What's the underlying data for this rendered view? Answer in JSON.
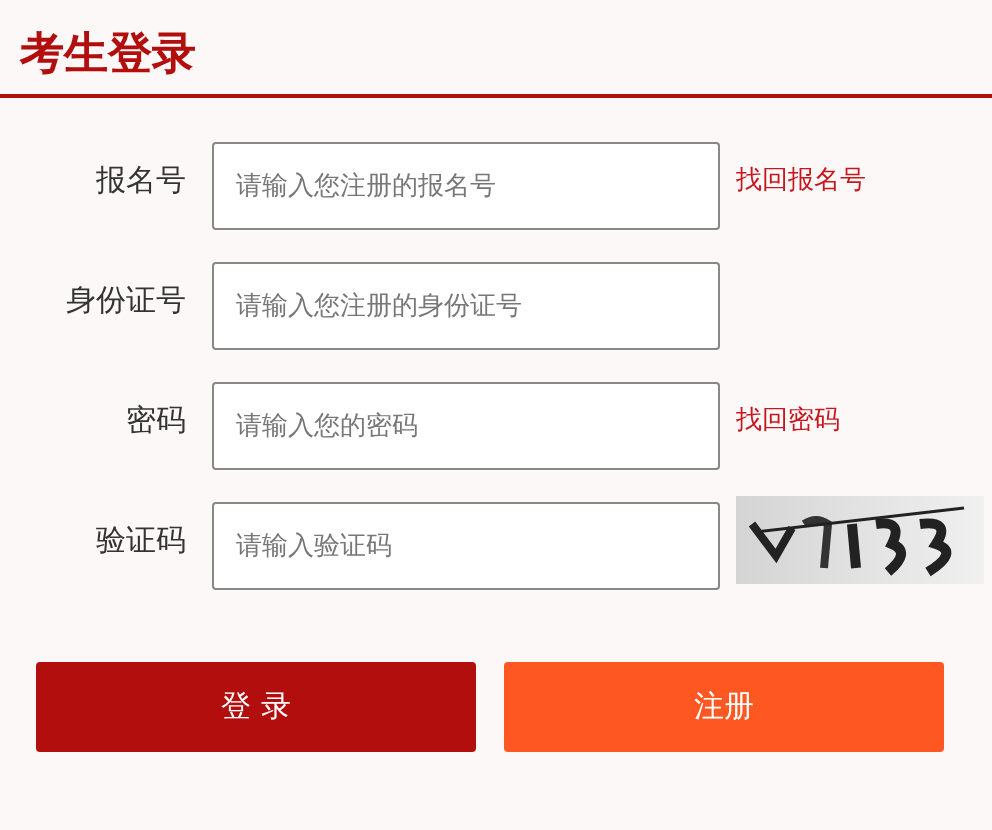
{
  "title": "考生登录",
  "fields": [
    {
      "kind": "text",
      "label": "报名号",
      "placeholder": "请输入您注册的报名号",
      "link": "找回报名号"
    },
    {
      "kind": "text",
      "label": "身份证号",
      "placeholder": "请输入您注册的身份证号"
    },
    {
      "kind": "password",
      "label": "密码",
      "placeholder": "请输入您的密码",
      "link": "找回密码"
    },
    {
      "kind": "captcha",
      "label": "验证码",
      "placeholder": "请输入验证码"
    }
  ],
  "buttons": [
    {
      "label": "登 录",
      "kind": "primary"
    },
    {
      "label": "注册",
      "kind": "secondary"
    }
  ]
}
